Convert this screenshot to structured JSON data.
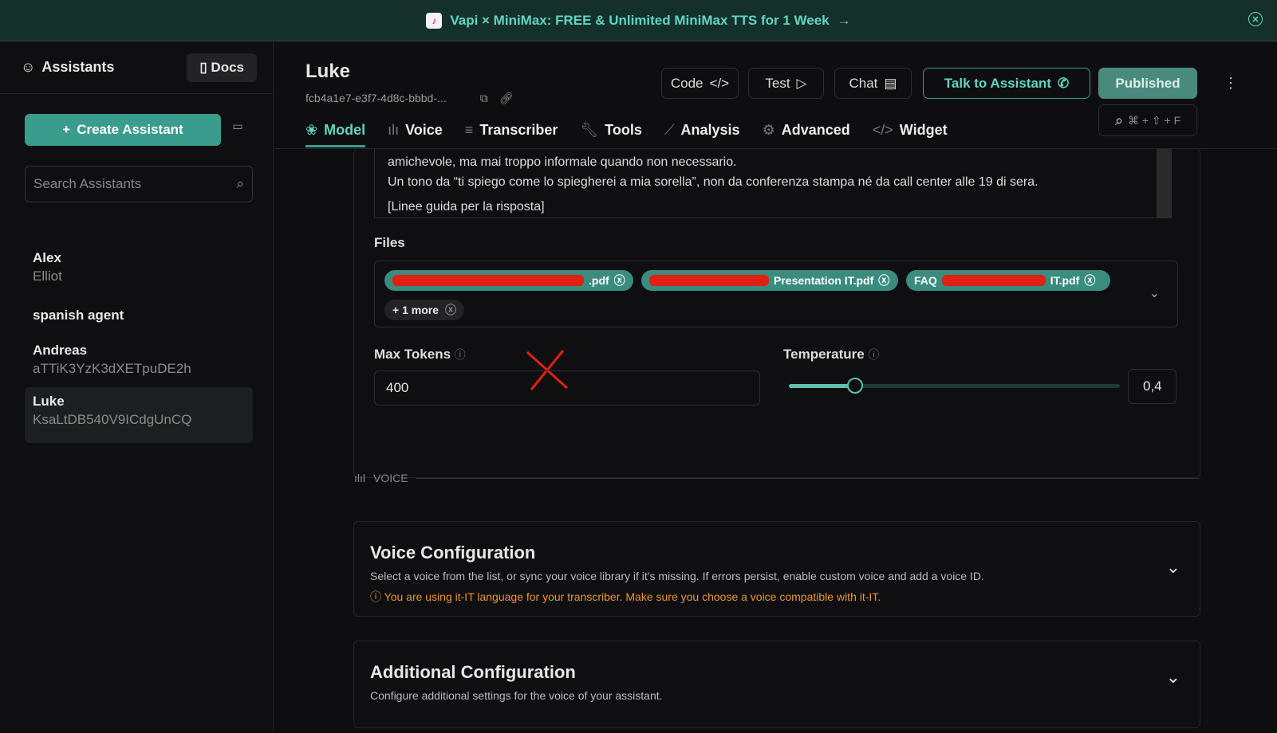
{
  "banner": {
    "text": "Vapi × MiniMax: FREE & Unlimited MiniMax TTS for 1 Week",
    "arrow": "→"
  },
  "sidebar": {
    "title": "Assistants",
    "docs": "Docs",
    "create": "Create Assistant",
    "search_placeholder": "Search Assistants",
    "assistants": [
      {
        "name": "Alex",
        "sub": "Elliot"
      },
      {
        "name": "spanish agent",
        "sub": ""
      },
      {
        "name": "Andreas",
        "sub": "aTTiK3YzK3dXETpuDE2h"
      },
      {
        "name": "Luke",
        "sub": "KsaLtDB540V9ICdgUnCQ"
      }
    ]
  },
  "header": {
    "title": "Luke",
    "id": "fcb4a1e7-e3f7-4d8c-bbbd-...",
    "code": "Code",
    "test": "Test",
    "chat": "Chat",
    "talk": "Talk to Assistant",
    "published": "Published",
    "shortcut": "⌘ + ⇧ + F"
  },
  "tabs": [
    "Model",
    "Voice",
    "Transcriber",
    "Tools",
    "Analysis",
    "Advanced",
    "Widget"
  ],
  "prompt": {
    "line1": "amichevole, ma mai troppo informale quando non necessario.",
    "line2": "Un tono da “ti spiego come lo spiegherei a mia sorella”, non da conferenza stampa né da call center alle 19 di sera.",
    "line3": "[Linee guida per la risposta]"
  },
  "files": {
    "label": "Files",
    "chips": [
      ".pdf",
      "Presentation IT.pdf",
      "IT.pdf"
    ],
    "chip3_prefix": "FAQ",
    "more": "+ 1 more"
  },
  "max_tokens": {
    "label": "Max Tokens",
    "value": "400"
  },
  "temperature": {
    "label": "Temperature",
    "value": "0,4",
    "fraction": 0.2
  },
  "voice_section": "VOICE",
  "voice_config": {
    "title": "Voice Configuration",
    "desc": "Select a voice from the list, or sync your voice library if it's missing. If errors persist, enable custom voice and add a voice ID.",
    "warning": "You are using it-IT language for your transcriber. Make sure you choose a voice compatible with it-IT."
  },
  "additional_config": {
    "title": "Additional Configuration",
    "desc": "Configure additional settings for the voice of your assistant."
  }
}
